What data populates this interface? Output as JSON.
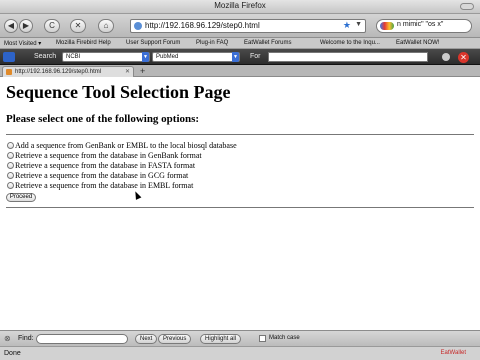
{
  "window": {
    "title": "Mozilla Firefox"
  },
  "nav": {
    "back": "◀",
    "forward": "▶",
    "reload": "C",
    "stop": "✕",
    "home": "⌂",
    "url": "http://192.168.96.129/step0.html",
    "search_query": "n mimic\" \"os x\""
  },
  "bookmarks": [
    "Most Visited ▾",
    "Mozilla Firebird Help",
    "User Support Forum",
    "Plug-in FAQ",
    "EatWallet Forums",
    "Welcome to the Inqu...",
    "EatWallet NOW!"
  ],
  "ncbi_toolbar": {
    "search_label": "Search",
    "search_value": "NCBI",
    "db_value": "PubMed",
    "for_label": "For"
  },
  "tab": {
    "label": "http://192.168.96.129/step0.html",
    "new_tab": "+"
  },
  "page": {
    "heading": "Sequence Tool Selection Page",
    "subheading": "Please select one of the following options:",
    "options": [
      "Add a sequence from GenBank or EMBL to the local biosql database",
      "Retrieve a sequence from the database in GenBank format",
      "Retrieve a sequence from the database in FASTA format",
      "Retrieve a sequence from the database in GCG format",
      "Retrieve a sequence from the database in EMBL format"
    ],
    "proceed_label": "Proceed"
  },
  "findbar": {
    "label": "Find:",
    "next": "Next",
    "previous": "Previous",
    "highlight": "Highlight all",
    "match_case": "Match case"
  },
  "status": {
    "text": "Done",
    "addon": "EatWallet"
  }
}
